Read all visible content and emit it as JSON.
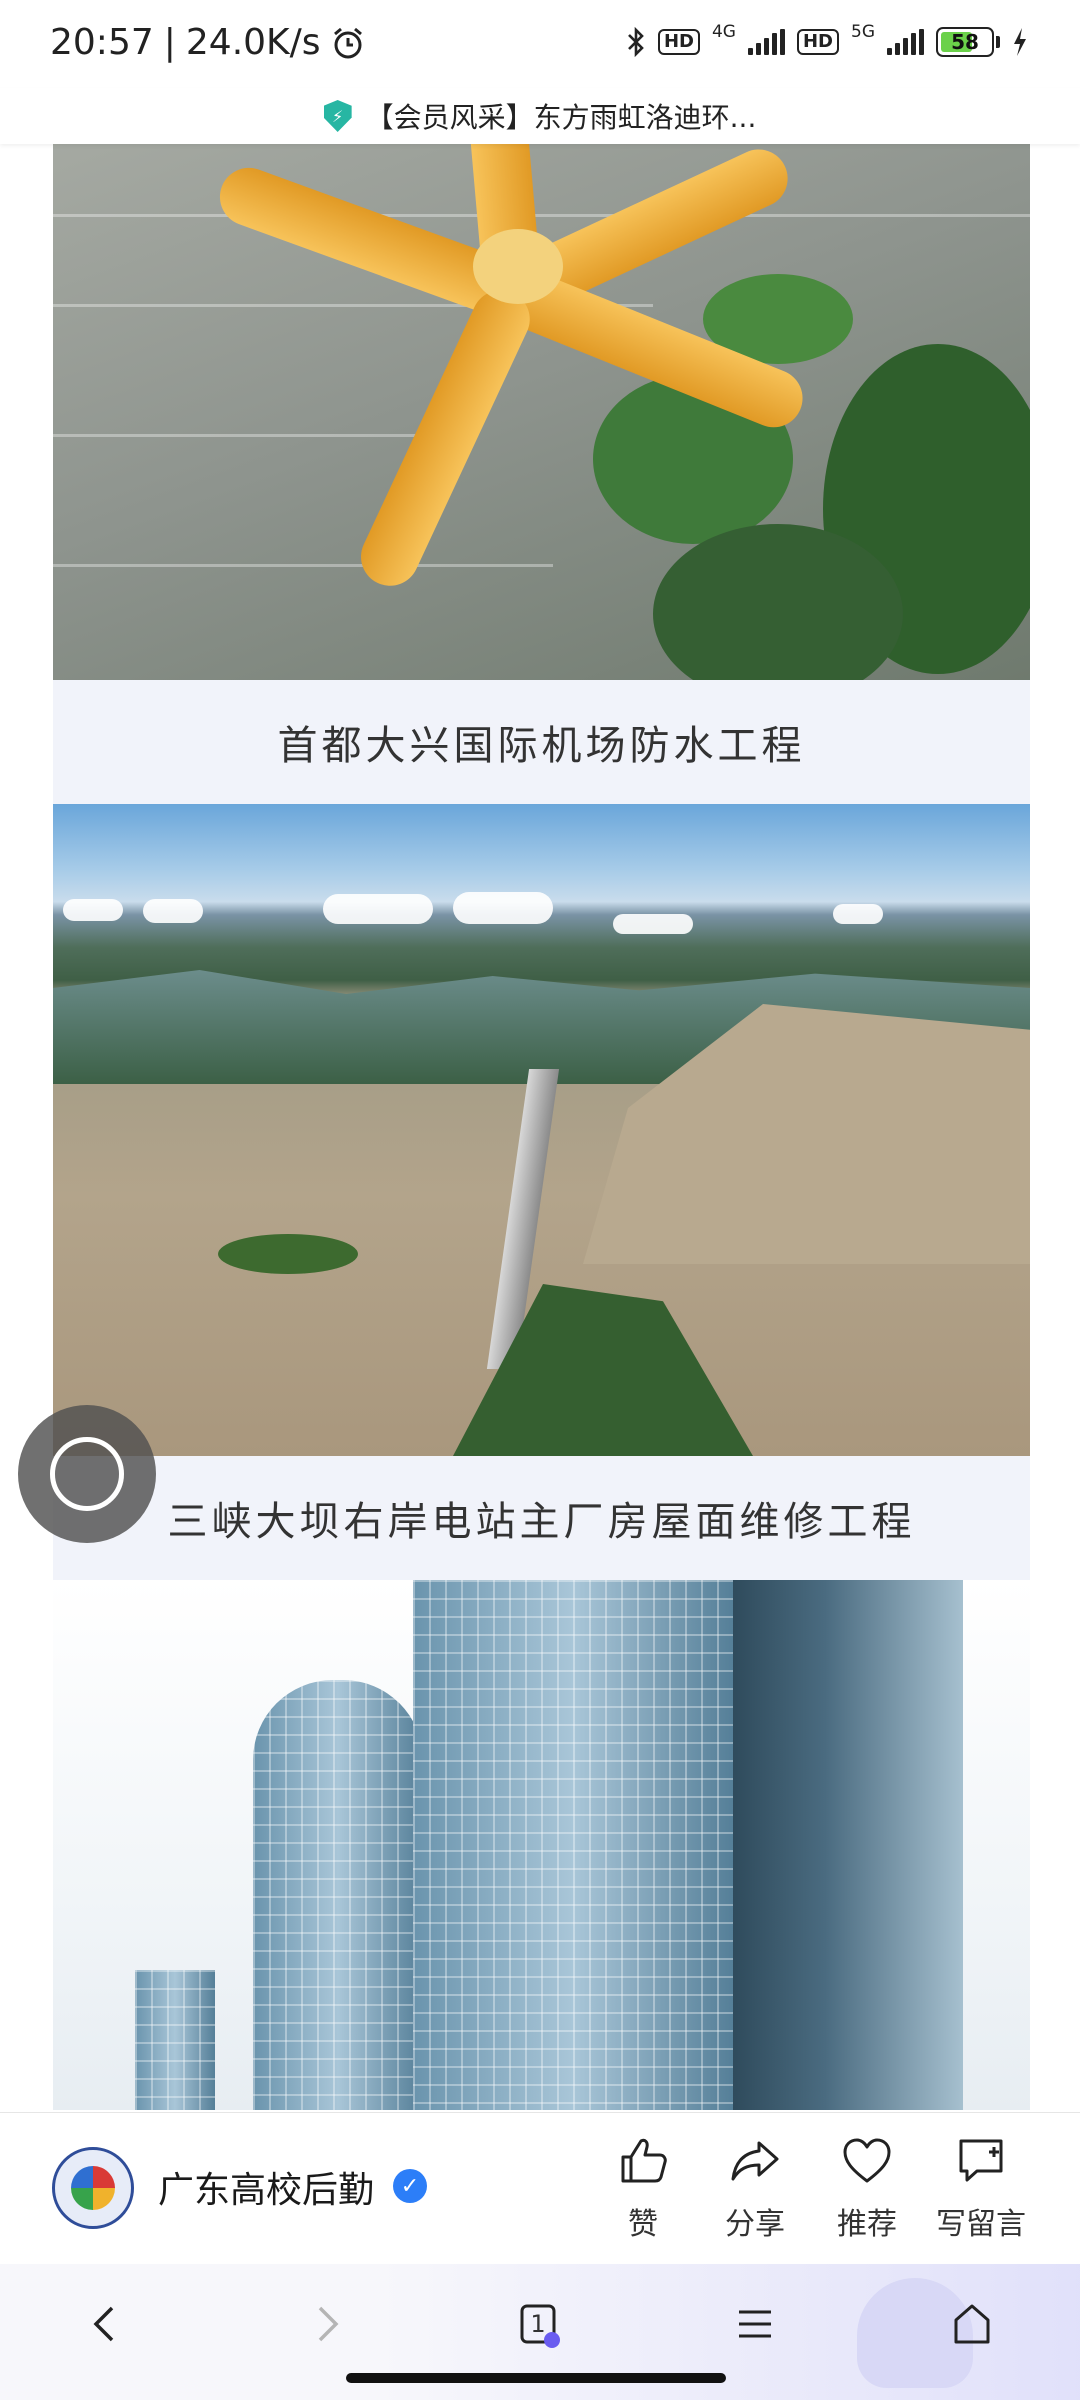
{
  "status_bar": {
    "time": "20:57",
    "separator": "|",
    "network_speed": "24.0K/s",
    "alarm_icon": "alarm-clock-icon",
    "bluetooth_icon": "bluetooth-icon",
    "hd_label_1": "HD",
    "network_1": "4G",
    "hd_label_2": "HD",
    "network_2": "5G",
    "battery_level": "58",
    "battery_fraction": 0.58,
    "charging_icon": "lightning-icon",
    "battery_color": "#6bd14a"
  },
  "header": {
    "shield_icon": "shield-icon",
    "title": "【会员风采】东方雨虹洛迪环..."
  },
  "article": {
    "items": [
      {
        "image_icon": "airport-photo",
        "caption": "首都大兴国际机场防水工程"
      },
      {
        "image_icon": "dam-photo",
        "caption": "三峡大坝右岸电站主厂房屋面维修工程"
      },
      {
        "image_icon": "building-photo"
      }
    ]
  },
  "floating_button": {
    "icon": "circle-ring-icon"
  },
  "action_bar": {
    "account_name": "广东高校后勤",
    "verified_icon": "verified-badge-icon",
    "actions": [
      {
        "icon": "thumbs-up-icon",
        "label": "赞"
      },
      {
        "icon": "share-arrow-icon",
        "label": "分享"
      },
      {
        "icon": "heart-icon",
        "label": "推荐"
      },
      {
        "icon": "comment-add-icon",
        "label": "写留言"
      }
    ]
  },
  "nav_bar": {
    "back_icon": "chevron-left-icon",
    "forward_icon": "chevron-right-icon",
    "tabs_count": "1",
    "menu_icon": "menu-icon",
    "home_icon": "home-icon",
    "accent": "#d8d8f6"
  }
}
